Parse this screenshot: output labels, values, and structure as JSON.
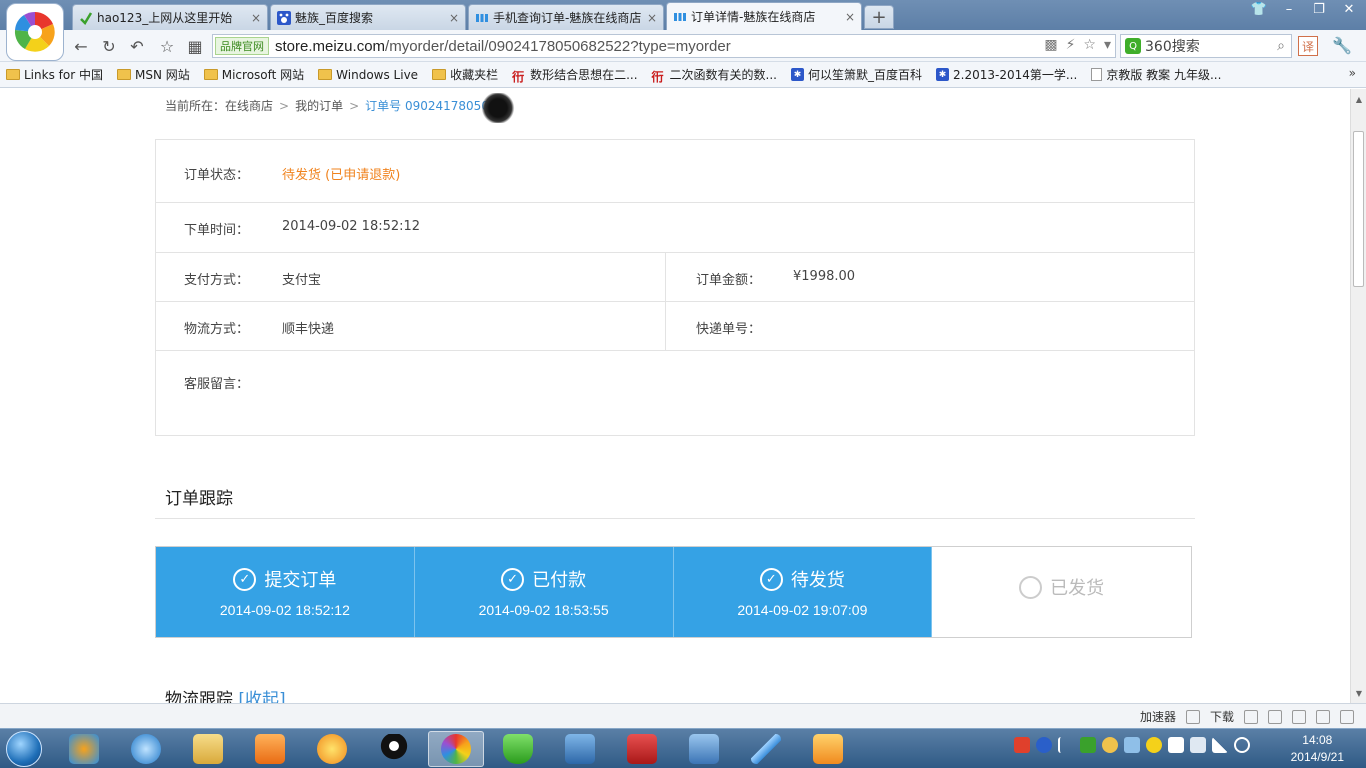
{
  "browser": {
    "tabs": [
      {
        "title": "hao123_上网从这里开始",
        "icon": "hao123-icon",
        "active": false
      },
      {
        "title": "魅族_百度搜索",
        "icon": "baidu-paw-icon",
        "active": false
      },
      {
        "title": "手机查询订单-魅族在线商店",
        "icon": "meizu-icon",
        "active": false
      },
      {
        "title": "订单详情-魅族在线商店",
        "icon": "meizu-icon",
        "active": true
      }
    ],
    "close_glyph": "×",
    "new_tab_glyph": "+",
    "window_controls": [
      "👕",
      "–",
      "❐",
      "✕"
    ],
    "brand_badge": "品牌官网",
    "url_host": "store.meizu.com",
    "url_path": "/myorder/detail/09024178050682522?type=myorder",
    "search_engine_label": "360搜索",
    "translate_label": "译",
    "bookmarks": [
      {
        "label": "Links for 中国",
        "icon": "folder"
      },
      {
        "label": "MSN 网站",
        "icon": "folder"
      },
      {
        "label": "Microsoft 网站",
        "icon": "folder"
      },
      {
        "label": "Windows Live",
        "icon": "folder"
      },
      {
        "label": "收藏夹栏",
        "icon": "folder"
      },
      {
        "label": "数形结合思想在二...",
        "icon": "rune"
      },
      {
        "label": "二次函数有关的数...",
        "icon": "rune"
      },
      {
        "label": "何以笙箫默_百度百科",
        "icon": "paw"
      },
      {
        "label": "2.2013-2014第一学...",
        "icon": "paw"
      },
      {
        "label": "京教版 教案 九年级...",
        "icon": "doc"
      }
    ],
    "bookmarks_more": "»"
  },
  "page": {
    "breadcrumb": {
      "prefix": "当前所在：在线商店",
      "sep": ">",
      "my_orders": "我的订单",
      "current": "订单号 0902417805068"
    },
    "order": {
      "status_label": "订单状态：",
      "status_value": "待发货 (已申请退款)",
      "time_label": "下单时间：",
      "time_value": "2014-09-02 18:52:12",
      "payment_label": "支付方式：",
      "payment_value": "支付宝",
      "amount_label": "订单金额：",
      "amount_value": "¥1998.00",
      "shipping_label": "物流方式：",
      "shipping_value": "顺丰快递",
      "tracking_label": "快递单号：",
      "tracking_value": "",
      "service_note_label": "客服留言：",
      "service_note_value": ""
    },
    "tracking_title": "订单跟踪",
    "steps": [
      {
        "label": "提交订单",
        "time": "2014-09-02 18:52:12",
        "done": true
      },
      {
        "label": "已付款",
        "time": "2014-09-02 18:53:55",
        "done": true
      },
      {
        "label": "待发货",
        "time": "2014-09-02 19:07:09",
        "done": true
      },
      {
        "label": "已发货",
        "time": "",
        "done": false
      }
    ],
    "logistics_title": "物流跟踪",
    "logistics_toggle": "[收起]"
  },
  "statusbar": {
    "accelerator": "加速器",
    "download": "下载"
  },
  "taskbar": {
    "time": "14:08",
    "date": "2014/9/21"
  },
  "colors": {
    "step_done": "#35a2e5",
    "status_orange": "#f0831e",
    "link_blue": "#3a8fd6"
  }
}
